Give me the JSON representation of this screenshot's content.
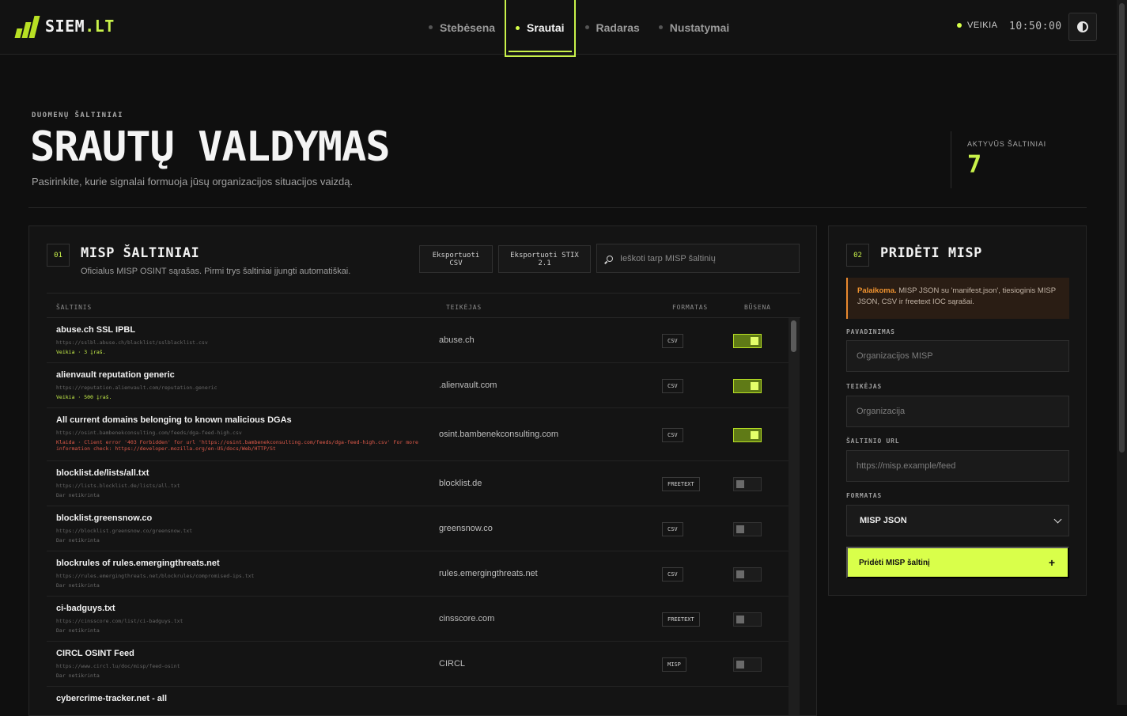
{
  "header": {
    "logo_name": "SIEM",
    "logo_tld": ".LT",
    "nav": [
      {
        "label": "Stebėsena"
      },
      {
        "label": "Srautai"
      },
      {
        "label": "Radaras"
      },
      {
        "label": "Nustatymai"
      }
    ],
    "active_nav": "Srautai",
    "status": "VEIKIA",
    "clock": "10:50:00"
  },
  "hero": {
    "eyebrow": "DUOMENŲ ŠALTINIAI",
    "title": "SRAUTŲ VALDYMAS",
    "subtitle": "Pasirinkite, kurie signalai formuoja jūsų organizacijos situacijos vaizdą.",
    "stat_label": "AKTYVŪS ŠALTINIAI",
    "stat_value": "7"
  },
  "misp": {
    "num": "01",
    "title": "MISP ŠALTINIAI",
    "subtitle": "Oficialus MISP OSINT sąrašas. Pirmi trys šaltiniai įjungti automatiškai.",
    "export_csv": "Eksportuoti CSV",
    "export_stix": "Eksportuoti STIX 2.1",
    "search_placeholder": "Ieškoti tarp MISP šaltinių",
    "columns": {
      "source": "ŠALTINIS",
      "provider": "TEIKĖJAS",
      "format": "FORMATAS",
      "state": "BŪSENA"
    },
    "rows": [
      {
        "name": "abuse.ch SSL IPBL",
        "url": "https://sslbl.abuse.ch/blacklist/sslblacklist.csv",
        "status": "Veikia · 3 įraš.",
        "status_kind": "ok",
        "provider": "abuse.ch",
        "format": "CSV",
        "enabled": true
      },
      {
        "name": "alienvault reputation generic",
        "url": "https://reputation.alienvault.com/reputation.generic",
        "status": "Veikia · 500 įraš.",
        "status_kind": "ok",
        "provider": ".alienvault.com",
        "format": "CSV",
        "enabled": true
      },
      {
        "name": "All current domains belonging to known malicious DGAs",
        "url": "https://osint.bambenekconsulting.com/feeds/dga-feed-high.csv",
        "status": "Klaida · Client error '403 Forbidden' for url 'https://osint.bambenekconsulting.com/feeds/dga-feed-high.csv' For more information check: https://developer.mozilla.org/en-US/docs/Web/HTTP/St",
        "status_kind": "err",
        "provider": "osint.bambenekconsulting.com",
        "format": "CSV",
        "enabled": true
      },
      {
        "name": "blocklist.de/lists/all.txt",
        "url": "https://lists.blocklist.de/lists/all.txt",
        "status": "Dar netikrinta",
        "status_kind": "none",
        "provider": "blocklist.de",
        "format": "FREETEXT",
        "enabled": false
      },
      {
        "name": "blocklist.greensnow.co",
        "url": "https://blocklist.greensnow.co/greensnow.txt",
        "status": "Dar netikrinta",
        "status_kind": "none",
        "provider": "greensnow.co",
        "format": "CSV",
        "enabled": false
      },
      {
        "name": "blockrules of rules.emergingthreats.net",
        "url": "https://rules.emergingthreats.net/blockrules/compromised-ips.txt",
        "status": "Dar netikrinta",
        "status_kind": "none",
        "provider": "rules.emergingthreats.net",
        "format": "CSV",
        "enabled": false
      },
      {
        "name": "ci-badguys.txt",
        "url": "https://cinsscore.com/list/ci-badguys.txt",
        "status": "Dar netikrinta",
        "status_kind": "none",
        "provider": "cinsscore.com",
        "format": "FREETEXT",
        "enabled": false
      },
      {
        "name": "CIRCL OSINT Feed",
        "url": "https://www.circl.lu/doc/misp/feed-osint",
        "status": "Dar netikrinta",
        "status_kind": "none",
        "provider": "CIRCL",
        "format": "MISP",
        "enabled": false
      },
      {
        "name": "cybercrime-tracker.net - all",
        "url": "",
        "status": "",
        "status_kind": "none",
        "provider": "",
        "format": "",
        "enabled": false
      }
    ]
  },
  "add": {
    "num": "02",
    "title": "PRIDĖTI MISP",
    "notice_strong": "Palaikoma.",
    "notice_text": " MISP JSON su 'manifest.json', tiesioginis MISP JSON, CSV ir freetext IOC sąrašai.",
    "name_label": "PAVADINIMAS",
    "name_placeholder": "Organizacijos MISP",
    "provider_label": "TEIKĖJAS",
    "provider_placeholder": "Organizacija",
    "url_label": "ŠALTINIO URL",
    "url_placeholder": "https://misp.example/feed",
    "format_label": "FORMATAS",
    "format_value": "MISP JSON",
    "submit_label": "Pridėti MISP šaltinį",
    "submit_icon": "+"
  },
  "colors": {
    "accent": "#c9f24a",
    "warning": "#e9892e",
    "error": "#e05a4a",
    "background": "#0f0f0f"
  }
}
